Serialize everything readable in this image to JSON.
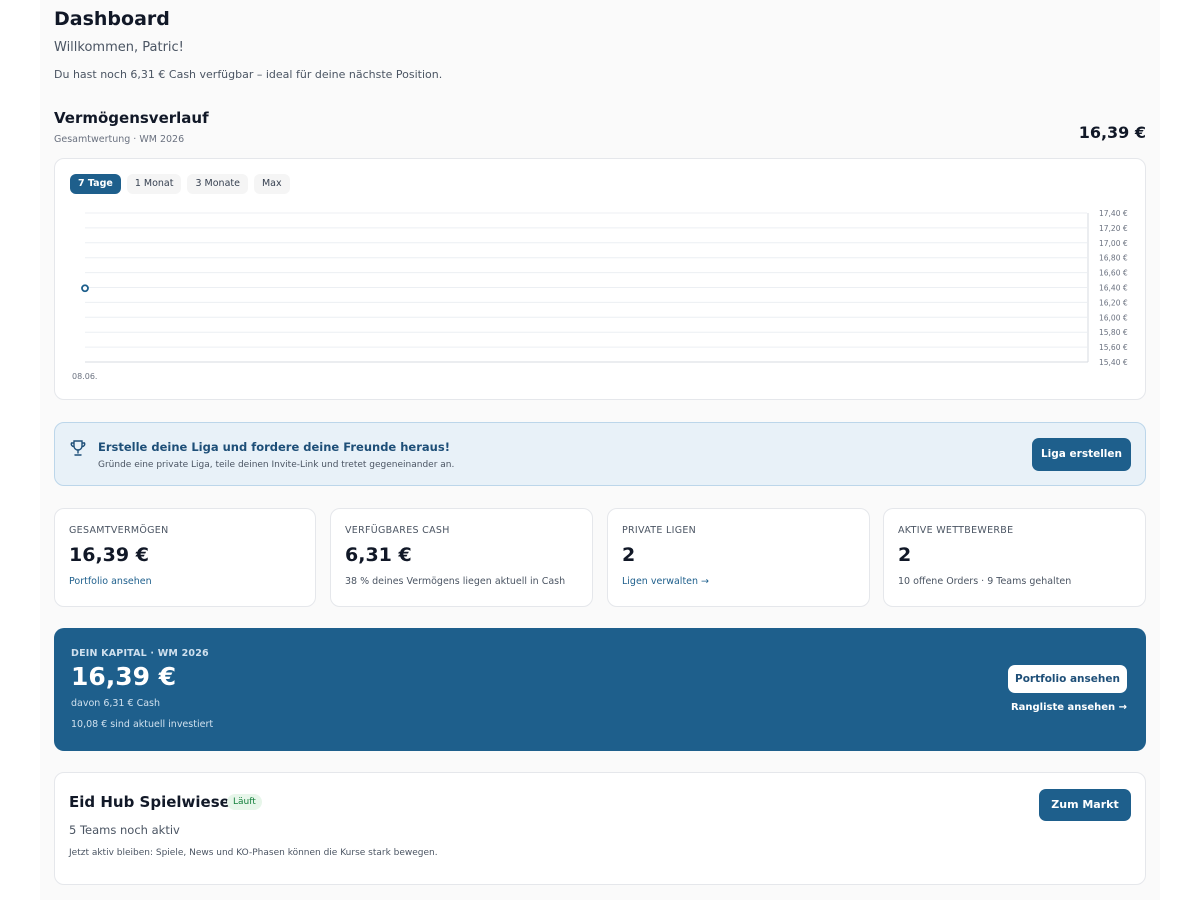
{
  "header": {
    "title": "Dashboard",
    "welcome": "Willkommen, Patric!",
    "cash_note": "Du hast noch 6,31 € Cash verfügbar – ideal für deine nächste Position."
  },
  "history": {
    "title": "Vermögensverlauf",
    "subtitle": "Gesamtwertung · WM 2026",
    "current_value": "16,39 €",
    "tabs": [
      {
        "label": "7 Tage",
        "active": true
      },
      {
        "label": "1 Monat",
        "active": false
      },
      {
        "label": "3 Monate",
        "active": false
      },
      {
        "label": "Max",
        "active": false
      }
    ]
  },
  "chart_data": {
    "type": "line",
    "x": [
      "08.06."
    ],
    "series": [
      {
        "values": [
          16.39
        ]
      }
    ],
    "ylim": [
      15.4,
      17.4
    ],
    "yticks": [
      17.4,
      17.2,
      17.0,
      16.8,
      16.6,
      16.4,
      16.2,
      16.0,
      15.8,
      15.6,
      15.4
    ],
    "ytick_labels": [
      "17,40 €",
      "17,20 €",
      "17,00 €",
      "16,80 €",
      "16,60 €",
      "16,40 €",
      "16,20 €",
      "16,00 €",
      "15,80 €",
      "15,60 €",
      "15,40 €"
    ],
    "xtick_labels": [
      "08.06."
    ],
    "grid": true,
    "y_axis_position": "right",
    "line_color": "#1e5f8c"
  },
  "banner": {
    "icon": "trophy-icon",
    "title": "Erstelle deine Liga und fordere deine Freunde heraus!",
    "subtitle": "Gründe eine private Liga, teile deinen Invite-Link und tretet gegeneinander an.",
    "button": "Liga erstellen"
  },
  "stats": [
    {
      "label": "GESAMTVERMÖGEN",
      "value": "16,39 €",
      "foot": "Portfolio ansehen",
      "foot_is_link": true
    },
    {
      "label": "VERFÜGBARES CASH",
      "value": "6,31 €",
      "foot": "38 % deines Vermögens liegen aktuell in Cash",
      "foot_is_link": false
    },
    {
      "label": "PRIVATE LIGEN",
      "value": "2",
      "foot": "Ligen verwalten →",
      "foot_is_link": true
    },
    {
      "label": "AKTIVE WETTBEWERBE",
      "value": "2",
      "foot": "10 offene Orders · 9 Teams gehalten",
      "foot_is_link": false
    }
  ],
  "capital": {
    "label": "DEIN KAPITAL · WM 2026",
    "value": "16,39 €",
    "cash": "davon 6,31 € Cash",
    "invested": "10,08 € sind aktuell investiert",
    "button": "Portfolio ansehen",
    "link": "Rangliste ansehen →"
  },
  "competition": {
    "title": "Eid Hub Spielwiese",
    "badge": "Läuft",
    "subtitle": "5 Teams noch aktiv",
    "note": "Jetzt aktiv bleiben: Spiele, News und KO-Phasen können die Kurse stark bewegen.",
    "button": "Zum Markt"
  },
  "colors": {
    "primary": "#1e5f8c",
    "banner_bg": "#e8f1f8",
    "badge_bg": "#e7f6ea",
    "badge_text": "#15803d"
  }
}
